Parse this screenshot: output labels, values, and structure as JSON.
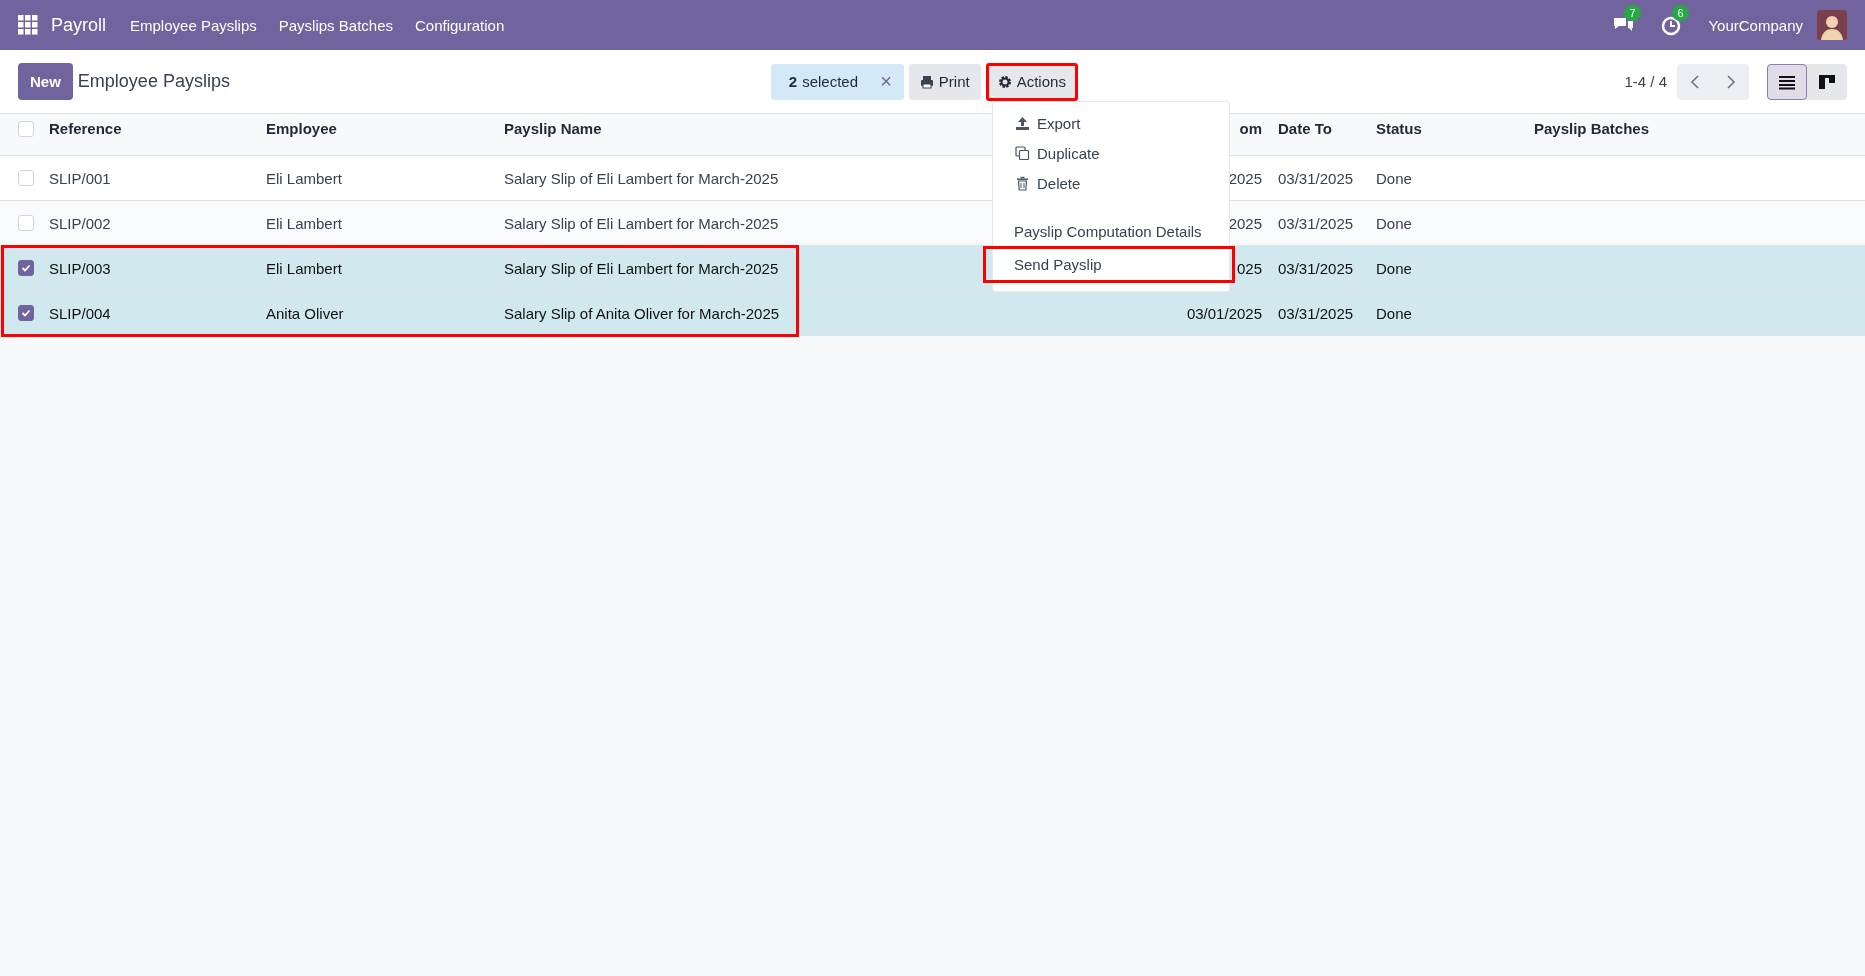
{
  "navbar": {
    "app": "Payroll",
    "menu": [
      "Employee Payslips",
      "Payslips Batches",
      "Configuration"
    ],
    "messages_badge": "7",
    "activities_badge": "6",
    "company": "YourCompany"
  },
  "control_panel": {
    "new_button": "New",
    "title": "Employee Payslips",
    "selection": {
      "count": "2",
      "label": "selected",
      "clear": "×"
    },
    "print_button": "Print",
    "actions_button": {
      "label": "Actions",
      "annotated": true
    },
    "pager": "1-4 / 4",
    "views": [
      {
        "kind": "list",
        "selected": true
      },
      {
        "kind": "kanban",
        "selected": false
      }
    ]
  },
  "table": {
    "select_all_checked": false,
    "selection_annotated": true,
    "columns": [
      "Reference",
      "Employee",
      "Payslip Name",
      "om",
      "Date To",
      "Status",
      "Payslip Batches"
    ],
    "rows": [
      {
        "selected": false,
        "cells": [
          "SLIP/001",
          "Eli Lambert",
          "Salary Slip of Eli Lambert for March-2025",
          "2025",
          "03/31/2025",
          "Done",
          ""
        ]
      },
      {
        "selected": false,
        "cells": [
          "SLIP/002",
          "Eli Lambert",
          "Salary Slip of Eli Lambert for March-2025",
          "2025",
          "03/31/2025",
          "Done",
          ""
        ]
      },
      {
        "selected": true,
        "cells": [
          "SLIP/003",
          "Eli Lambert",
          "Salary Slip of Eli Lambert for March-2025",
          "025",
          "03/31/2025",
          "Done",
          ""
        ]
      },
      {
        "selected": true,
        "cells": [
          "SLIP/004",
          "Anita Oliver",
          "Salary Slip of Anita Oliver for March-2025",
          "03/01/2025",
          "03/31/2025",
          "Done",
          ""
        ]
      }
    ]
  },
  "actions_menu": {
    "items": [
      {
        "kind": "icon",
        "label": "Export",
        "annotated": false
      },
      {
        "kind": "icon",
        "label": "Duplicate",
        "annotated": false
      },
      {
        "kind": "icon",
        "label": "Delete",
        "annotated": false
      },
      {
        "kind": "separator"
      },
      {
        "kind": "plain",
        "label": "Payslip Computation Details",
        "annotated": false
      },
      {
        "kind": "plain",
        "label": "Send Payslip",
        "annotated": true
      }
    ]
  }
}
